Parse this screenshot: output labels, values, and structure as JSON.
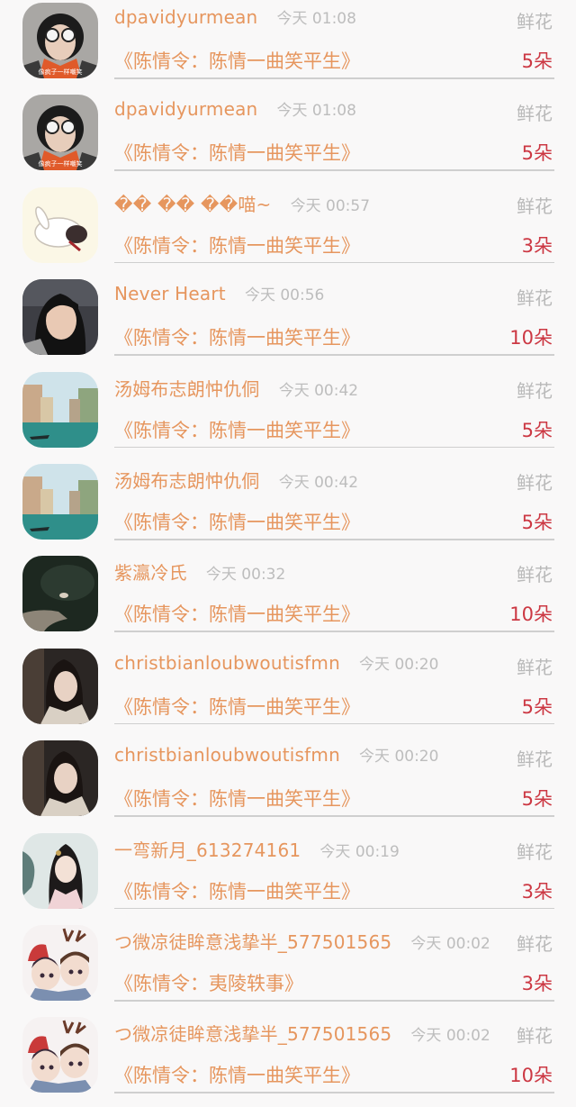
{
  "rows": [
    {
      "name": "dpavidyurmean",
      "time": "今天 01:08",
      "gift": "鲜花",
      "title": "《陈情令：陈情一曲笑平生》",
      "count": "5朵",
      "avatar_caption": "像疯子一样嘲笑"
    },
    {
      "name": "dpavidyurmean",
      "time": "今天 01:08",
      "gift": "鲜花",
      "title": "《陈情令：陈情一曲笑平生》",
      "count": "5朵",
      "avatar_caption": "像疯子一样嘲笑"
    },
    {
      "name": "�� �� ��喵~",
      "time": "今天 00:57",
      "gift": "鲜花",
      "title": "《陈情令：陈情一曲笑平生》",
      "count": "3朵"
    },
    {
      "name": "Never Heart",
      "time": "今天 00:56",
      "gift": "鲜花",
      "title": "《陈情令：陈情一曲笑平生》",
      "count": "10朵"
    },
    {
      "name": "汤姆布志朗忡仇侗",
      "time": "今天 00:42",
      "gift": "鲜花",
      "title": "《陈情令：陈情一曲笑平生》",
      "count": "5朵"
    },
    {
      "name": "汤姆布志朗忡仇侗",
      "time": "今天 00:42",
      "gift": "鲜花",
      "title": "《陈情令：陈情一曲笑平生》",
      "count": "5朵"
    },
    {
      "name": "紫瀛冷氏",
      "time": "今天 00:32",
      "gift": "鲜花",
      "title": "《陈情令：陈情一曲笑平生》",
      "count": "10朵"
    },
    {
      "name": "christbianloubwoutisfmn",
      "time": "今天 00:20",
      "gift": "鲜花",
      "title": "《陈情令：陈情一曲笑平生》",
      "count": "5朵"
    },
    {
      "name": "christbianloubwoutisfmn",
      "time": "今天 00:20",
      "gift": "鲜花",
      "title": "《陈情令：陈情一曲笑平生》",
      "count": "5朵"
    },
    {
      "name": "一弯新月_613274161",
      "time": "今天 00:19",
      "gift": "鲜花",
      "title": "《陈情令：陈情一曲笑平生》",
      "count": "3朵"
    },
    {
      "name": "つ微凉徒眸意浅挚半_577501565",
      "time": "今天 00:02",
      "gift": "鲜花",
      "title": "《陈情令：夷陵轶事》",
      "count": "3朵"
    },
    {
      "name": "つ微凉徒眸意浅挚半_577501565",
      "time": "今天 00:02",
      "gift": "鲜花",
      "title": "《陈情令：陈情一曲笑平生》",
      "count": "10朵"
    }
  ]
}
